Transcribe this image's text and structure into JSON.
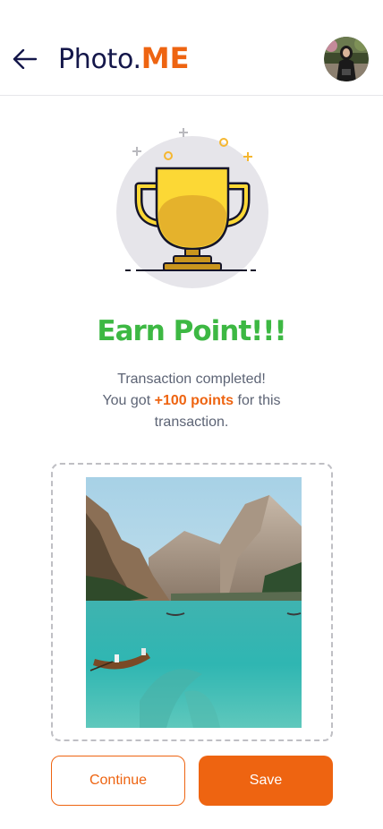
{
  "header": {
    "logo_main": "Photo.",
    "logo_accent": "ME",
    "back_icon": "arrow-left-icon",
    "avatar_icon": "user-avatar"
  },
  "reward": {
    "illustration": "trophy-icon",
    "title": "Earn Point!!!",
    "message_line1": "Transaction completed!",
    "message_prefix": "You got ",
    "points": "+100 points",
    "message_suffix": " for this transaction."
  },
  "photo": {
    "alt": "Turquoise mountain lake with a wooden rowboat"
  },
  "actions": {
    "continue_label": "Continue",
    "save_label": "Save"
  },
  "colors": {
    "brand_navy": "#14174a",
    "accent_orange": "#ee6411",
    "success_green": "#3db843",
    "trophy_gold": "#fcd835",
    "text_muted": "#5d6475"
  }
}
